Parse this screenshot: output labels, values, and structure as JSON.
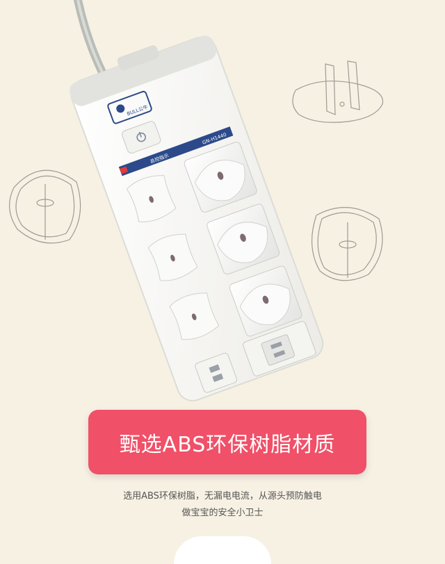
{
  "product": {
    "brand": "BULL公牛",
    "model_label": "GN-H1440",
    "indicator_label": "总控指示"
  },
  "banner": {
    "title": "甄选ABS环保树脂材质"
  },
  "description": {
    "line1": "选用ABS环保树脂，无漏电电流，从源头预防触电",
    "line2": "做宝宝的安全小卫士"
  },
  "colors": {
    "background": "#f7f1e4",
    "banner": "#f05068",
    "power_strip": "#fbfbf9",
    "cable": "#b9bdb8"
  },
  "icons": [
    "power-switch-icon",
    "bull-logo-icon",
    "child-safety-plug-icon"
  ]
}
